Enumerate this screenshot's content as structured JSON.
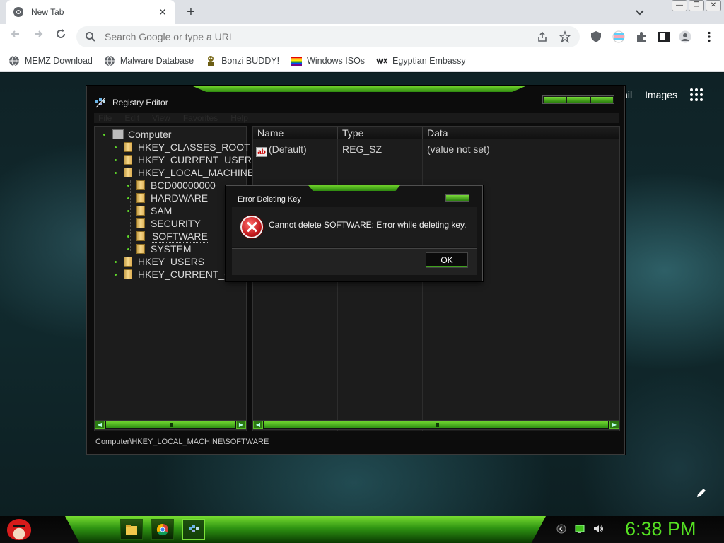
{
  "browser": {
    "tab": {
      "title": "New Tab"
    },
    "new_tab_symbol": "+",
    "window_controls": {
      "minimize": "—",
      "maximize": "❐",
      "close": "✕"
    },
    "omnibox": {
      "placeholder": "Search Google or type a URL"
    },
    "bookmarks": [
      {
        "label": "MEMZ Download",
        "icon": "globe-icon"
      },
      {
        "label": "Malware Database",
        "icon": "globe-icon"
      },
      {
        "label": "Bonzi BUDDY!",
        "icon": "bonzi-icon"
      },
      {
        "label": "Windows ISOs",
        "icon": "windows-flag-icon"
      },
      {
        "label": "Egyptian Embassy",
        "icon": "wix-icon"
      }
    ],
    "google_links": {
      "mail": "ail",
      "images": "Images"
    }
  },
  "registry_editor": {
    "title": "Registry Editor",
    "menu": [
      "File",
      "Edit",
      "View",
      "Favorites",
      "Help"
    ],
    "tree": {
      "root": "Computer",
      "hkeys": {
        "classes_root": "HKEY_CLASSES_ROOT",
        "current_user": "HKEY_CURRENT_USER",
        "local_machine": "HKEY_LOCAL_MACHINE",
        "users": "HKEY_USERS",
        "current_config": "HKEY_CURRENT_C"
      },
      "local_machine_children": [
        "BCD00000000",
        "HARDWARE",
        "SAM",
        "SECURITY",
        "SOFTWARE",
        "SYSTEM"
      ],
      "selected": "SOFTWARE"
    },
    "columns": {
      "name": "Name",
      "type": "Type",
      "data": "Data"
    },
    "values": [
      {
        "name": "(Default)",
        "type": "REG_SZ",
        "data": "(value not set)",
        "icon": "ab"
      }
    ],
    "status_path": "Computer\\HKEY_LOCAL_MACHINE\\SOFTWARE"
  },
  "error_dialog": {
    "title": "Error Deleting Key",
    "message": "Cannot delete SOFTWARE:  Error while deleting key.",
    "ok_label": "OK"
  },
  "taskbar": {
    "clock": "6:38 PM",
    "apps": [
      "file-explorer-icon",
      "chrome-icon",
      "registry-editor-icon"
    ],
    "tray": [
      "network-back-icon",
      "monitor-icon",
      "speaker-icon"
    ]
  },
  "colors": {
    "accent_green": "#4cd41e",
    "clock_green": "#55e022",
    "error_red": "#c0161a"
  }
}
